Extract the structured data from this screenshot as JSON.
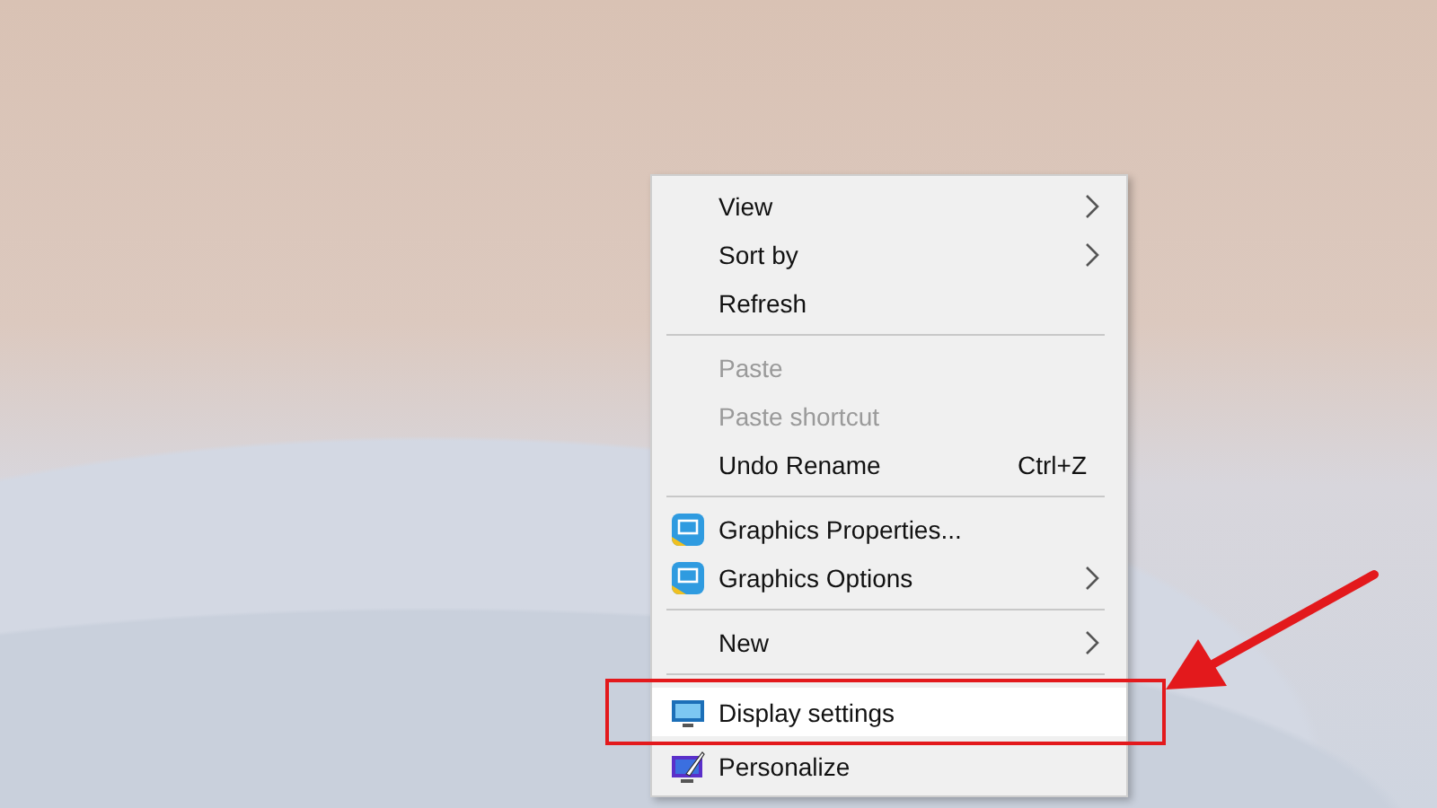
{
  "context_menu": {
    "groups": [
      [
        {
          "kind": "plain",
          "label": "View",
          "disabled": false,
          "submenu": true,
          "selected": false
        },
        {
          "kind": "plain",
          "label": "Sort by",
          "disabled": false,
          "submenu": true,
          "selected": false
        },
        {
          "kind": "plain",
          "label": "Refresh",
          "disabled": false,
          "submenu": false,
          "selected": false
        }
      ],
      [
        {
          "kind": "plain",
          "label": "Paste",
          "disabled": true,
          "submenu": false,
          "selected": false
        },
        {
          "kind": "plain",
          "label": "Paste shortcut",
          "disabled": true,
          "submenu": false,
          "selected": false
        },
        {
          "kind": "plain",
          "label": "Undo Rename",
          "shortcut": "Ctrl+Z",
          "disabled": false,
          "submenu": false,
          "selected": false
        }
      ],
      [
        {
          "kind": "graphics",
          "label": "Graphics Properties...",
          "disabled": false,
          "submenu": false,
          "selected": false
        },
        {
          "kind": "graphics",
          "label": "Graphics Options",
          "disabled": false,
          "submenu": true,
          "selected": false
        }
      ],
      [
        {
          "kind": "plain",
          "label": "New",
          "disabled": false,
          "submenu": true,
          "selected": false
        }
      ],
      [
        {
          "kind": "display",
          "label": "Display settings",
          "disabled": false,
          "submenu": false,
          "selected": true
        },
        {
          "kind": "personalize",
          "label": "Personalize",
          "disabled": false,
          "submenu": false,
          "selected": false
        }
      ]
    ]
  }
}
